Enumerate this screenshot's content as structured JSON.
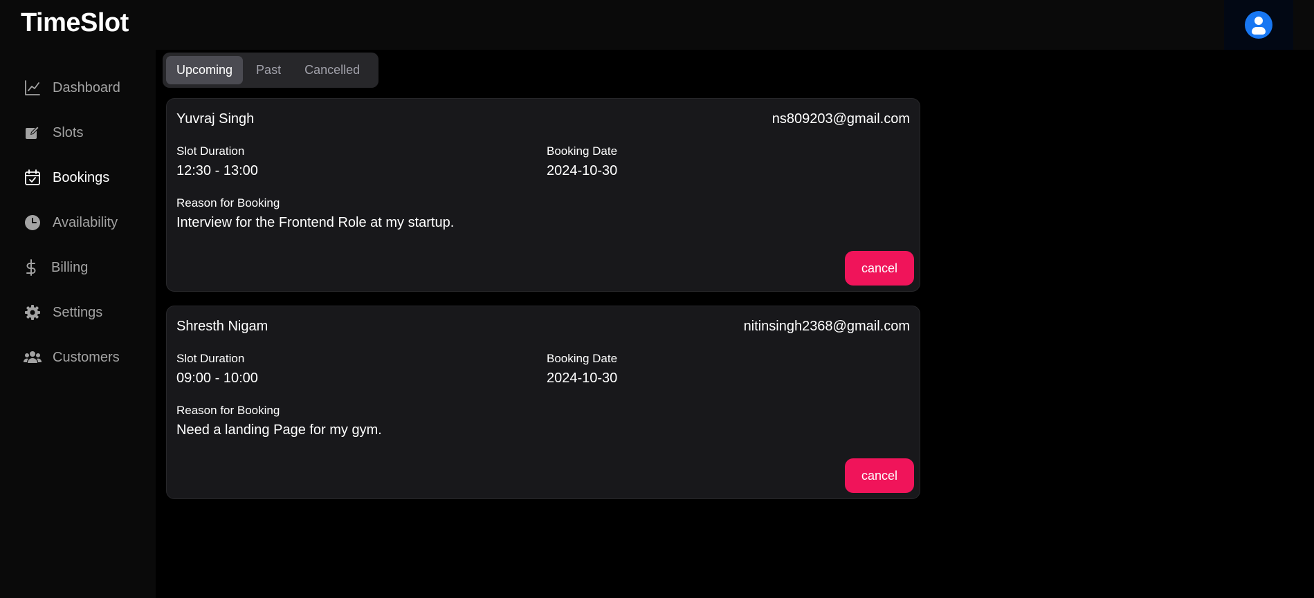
{
  "app": {
    "brand": "TimeSlot"
  },
  "header": {
    "avatar_icon": "user-circle-icon",
    "avatar_color": "#1877f2"
  },
  "sidebar": {
    "items": [
      {
        "label": "Dashboard",
        "icon": "line-chart-icon",
        "active": false
      },
      {
        "label": "Slots",
        "icon": "edit-icon",
        "active": false
      },
      {
        "label": "Bookings",
        "icon": "calendar-check-icon",
        "active": true
      },
      {
        "label": "Availability",
        "icon": "clock-icon",
        "active": false
      },
      {
        "label": "Billing",
        "icon": "dollar-icon",
        "active": false
      },
      {
        "label": "Settings",
        "icon": "gear-icon",
        "active": false
      },
      {
        "label": "Customers",
        "icon": "users-icon",
        "active": false
      }
    ]
  },
  "tabs": [
    {
      "label": "Upcoming",
      "active": true
    },
    {
      "label": "Past",
      "active": false
    },
    {
      "label": "Cancelled",
      "active": false
    }
  ],
  "labels": {
    "slot_duration": "Slot Duration",
    "booking_date": "Booking Date",
    "reason": "Reason for Booking",
    "cancel": "cancel"
  },
  "bookings": [
    {
      "name": "Yuvraj Singh",
      "email": "ns809203@gmail.com",
      "slot_duration": "12:30 - 13:00",
      "booking_date": "2024-10-30",
      "reason": "Interview for the Frontend Role at my startup."
    },
    {
      "name": "Shresth Nigam",
      "email": "nitinsingh2368@gmail.com",
      "slot_duration": "09:00 - 10:00",
      "booking_date": "2024-10-30",
      "reason": "Need a landing Page for my gym."
    }
  ],
  "colors": {
    "accent_cancel": "#f0145a",
    "card_bg": "#18181b",
    "page_bg": "#000000"
  }
}
